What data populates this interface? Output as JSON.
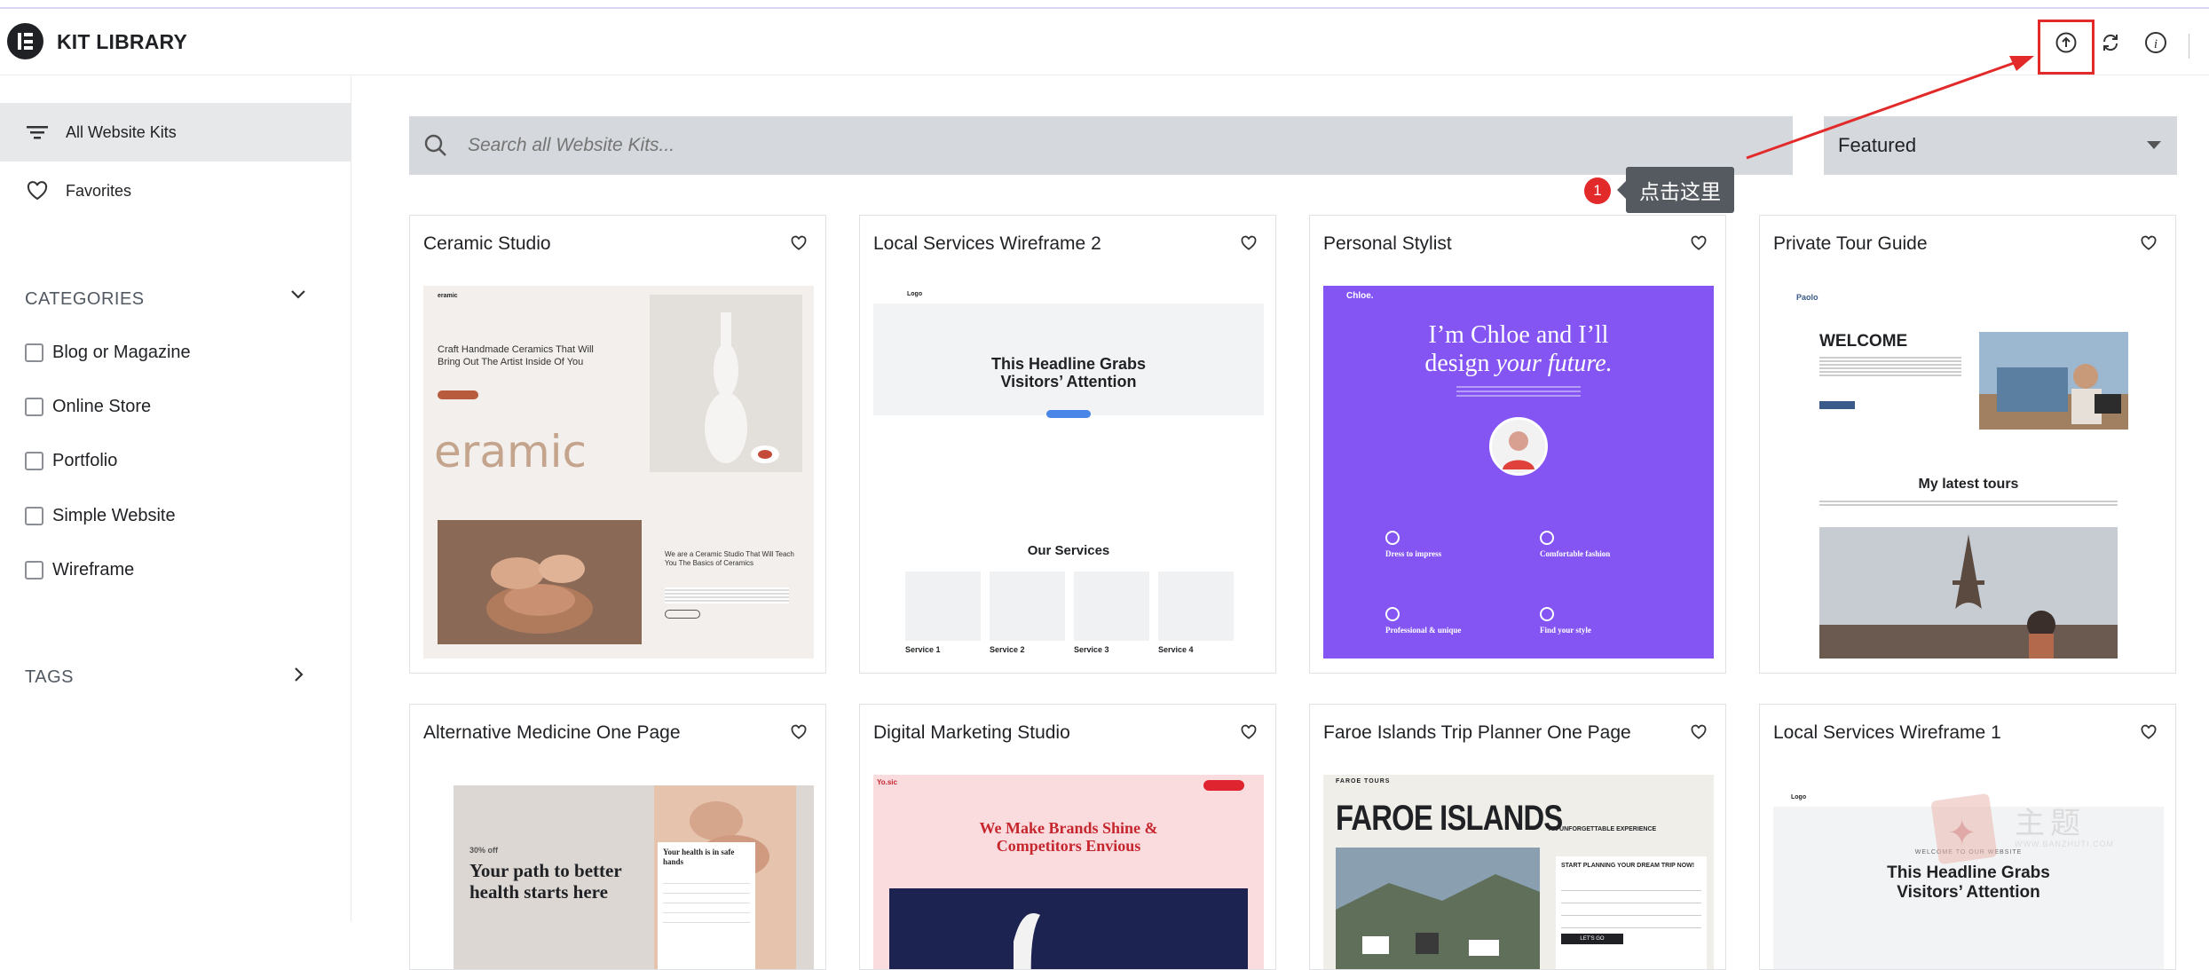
{
  "app": {
    "title": "KIT LIBRARY",
    "logo_icon": "elementor-logo-icon"
  },
  "header": {
    "buttons": [
      {
        "name": "import-kit-button",
        "icon": "upload-circle-icon"
      },
      {
        "name": "sync-button",
        "icon": "refresh-icon"
      },
      {
        "name": "info-button",
        "icon": "info-icon"
      }
    ]
  },
  "annotation": {
    "badge": "1",
    "tooltip": "点击这里",
    "highlight_color": "#e22a2a"
  },
  "sidebar": {
    "nav": [
      {
        "label": "All Website Kits",
        "icon": "filter-icon",
        "active": true
      },
      {
        "label": "Favorites",
        "icon": "heart-icon",
        "active": false
      }
    ],
    "categories_title": "CATEGORIES",
    "categories": [
      "Blog or Magazine",
      "Online Store",
      "Portfolio",
      "Simple Website",
      "Wireframe"
    ],
    "tags_title": "TAGS"
  },
  "search": {
    "placeholder": "Search all Website Kits..."
  },
  "sort": {
    "selected": "Featured"
  },
  "kits": [
    {
      "title": "Ceramic Studio",
      "preview": {
        "hero": "Craft Handmade Ceramics That Will Bring Out The Artist Inside Of You",
        "word": "eramic",
        "logo": "eramic",
        "sub": "We are a Ceramic Studio That Will Teach You The Basics of Ceramics"
      }
    },
    {
      "title": "Local Services Wireframe 2",
      "preview": {
        "logo": "Logo",
        "headline": "This Headline Grabs Visitors’ Attention",
        "section": "Our Services",
        "services": [
          "Service 1",
          "Service 2",
          "Service 3",
          "Service 4"
        ]
      }
    },
    {
      "title": "Personal Stylist",
      "preview": {
        "logo": "Chloe.",
        "headline1": "I’m Chloe and I’ll",
        "headline2": "design ",
        "headline3": "your future.",
        "features": [
          "Dress to impress",
          "Comfortable fashion",
          "Professional & unique",
          "Find your style"
        ]
      }
    },
    {
      "title": "Private Tour Guide",
      "preview": {
        "logo": "Paolo",
        "welcome": "WELCOME",
        "section": "My latest tours"
      }
    },
    {
      "title": "Alternative Medicine One Page",
      "preview": {
        "offer": "30% off",
        "headline": "Your path to better health starts here",
        "form": "Your health is in safe hands"
      }
    },
    {
      "title": "Digital Marketing Studio",
      "preview": {
        "logo": "Yo.sic",
        "headline": "We Make Brands Shine & Competitors Envious"
      }
    },
    {
      "title": "Faroe Islands Trip Planner One Page",
      "preview": {
        "logo": "FAROE TOURS",
        "headline": "FAROE ISLANDS",
        "tagline": "AN UNFORGETTABLE EXPERIENCE",
        "cta": "START PLANNING YOUR DREAM TRIP NOW!",
        "button": "LET'S GO"
      }
    },
    {
      "title": "Local Services Wireframe 1",
      "preview": {
        "logo": "Logo",
        "kicker": "WELCOME TO OUR WEBSITE",
        "headline": "This Headline Grabs Visitors’ Attention"
      }
    }
  ],
  "watermark": {
    "text1": "主题",
    "text2": "WWW.BANZHUTI.COM"
  }
}
